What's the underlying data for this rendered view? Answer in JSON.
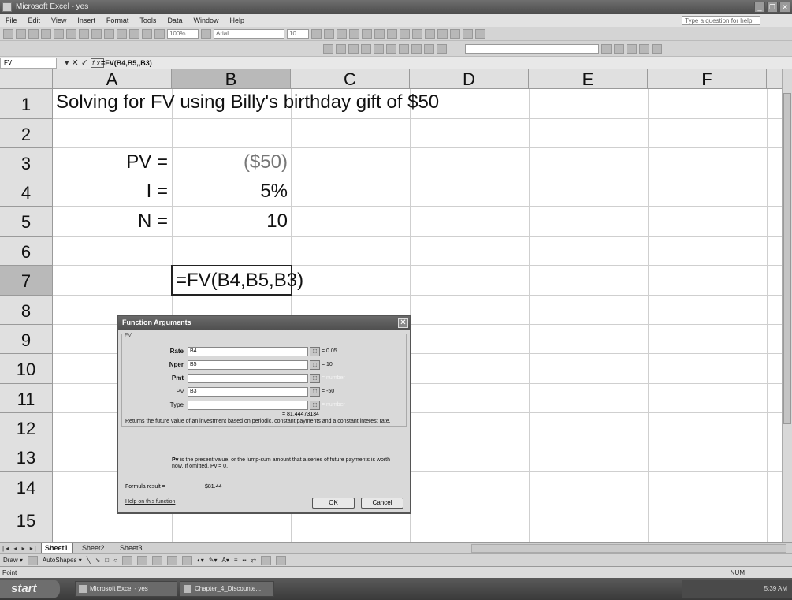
{
  "window": {
    "title": "Microsoft Excel - yes"
  },
  "menu": [
    "File",
    "Edit",
    "View",
    "Insert",
    "Format",
    "Tools",
    "Data",
    "Window",
    "Help"
  ],
  "help_box": "Type a question for help",
  "toolbar": {
    "zoom": "100%",
    "font": "Arial",
    "size": "10"
  },
  "formula_bar": {
    "name_box": "FV",
    "formula": "=FV(B4,B5,,B3)"
  },
  "columns": [
    "A",
    "B",
    "C",
    "D",
    "E",
    "F"
  ],
  "rows": [
    "1",
    "2",
    "3",
    "4",
    "5",
    "6",
    "7",
    "8",
    "9",
    "10",
    "11",
    "12",
    "13",
    "14",
    "15"
  ],
  "cells": {
    "a1": "Solving for FV using Billy's birthday gift of $50",
    "a3": "PV =",
    "b3": "($50)",
    "a4": "I =",
    "b4": "5%",
    "a5": "N =",
    "b5": "10",
    "b7": "=FV(B4,B5,B3)"
  },
  "dialog": {
    "title": "Function Arguments",
    "close": "✕",
    "function": "FV",
    "args": [
      {
        "label": "Rate",
        "value": "B4",
        "result": "= 0.05"
      },
      {
        "label": "Nper",
        "value": "B5",
        "result": "= 10"
      },
      {
        "label": "Pmt",
        "value": "",
        "result": "= number"
      },
      {
        "label": "Pv",
        "value": "B3",
        "result": "= -50"
      },
      {
        "label": "Type",
        "value": "",
        "result": "= number"
      }
    ],
    "result": "= 81.44473134",
    "description": "Returns the future value of an investment based on periodic, constant payments and a constant interest rate.",
    "pv_bold": "Pv",
    "pv_text": " is the present value, or the lump-sum amount that a series of future payments is worth now. If omitted, Pv = 0.",
    "formula_result_label": "Formula result =",
    "formula_result_value": "$81.44",
    "help_link": "Help on this function",
    "ok": "OK",
    "cancel": "Cancel"
  },
  "sheets": [
    "Sheet1",
    "Sheet2",
    "Sheet3"
  ],
  "drawbar": {
    "draw": "Draw ▾",
    "autoshapes": "AutoShapes ▾"
  },
  "status": {
    "mode": "Point",
    "num": "NUM"
  },
  "taskbar": {
    "start": "start",
    "item1": "Microsoft Excel - yes",
    "item2": "Chapter_4_Discounte...",
    "time": "5:39 AM"
  }
}
